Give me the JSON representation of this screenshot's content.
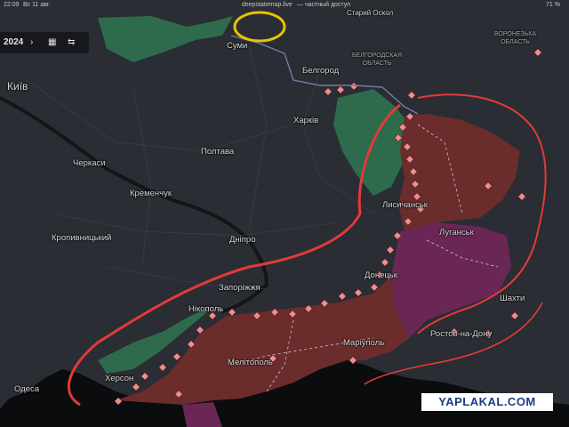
{
  "status_bar": {
    "time": "22:09",
    "date": "Вс 11 авг.",
    "url": "deepstatemap.live",
    "url_note": "— частный доступ",
    "battery": "71 %"
  },
  "toolbar": {
    "year": "2024",
    "next_icon": "chevron-right-icon",
    "calendar_icon": "calendar-icon",
    "collapse_icon": "collapse-arrows-icon"
  },
  "cities": {
    "sumy": "Суми",
    "belgorod": "Белгород",
    "belgorod_oblast": "БЕЛГОРОДСКАЯ\nОБЛАСТЬ",
    "voronezh_oblast": "ВОРОНЕЗЬКА\nОБЛАСТЬ",
    "stary_oskol": "Старий Оскол",
    "kharkiv": "Харків",
    "poltava": "Полтава",
    "cherkasy": "Черкаси",
    "kremenchuk": "Кременчук",
    "kropyvnytskyi": "Кропивницький",
    "dnipro": "Дніпро",
    "zaporizhzhia": "Запоріжжя",
    "nikopol": "Нікополь",
    "melitopol": "Мелітополь",
    "mariupol": "Маріуполь",
    "lysychansk": "Лисичанськ",
    "luhansk": "Луганськ",
    "donetsk": "Донецьк",
    "shakhty": "Шахти",
    "rostov": "Ростов-на-Дону",
    "kherson": "Херсон",
    "odesa": "Одеса",
    "kyiv": "Київ"
  },
  "watermark": "YAPLAKAL.COM",
  "colors": {
    "land": "#2a2d33",
    "occupied": "#6b2c2c",
    "occupied_pre2022": "#6a2755",
    "liberated": "#2e6b4c",
    "contested": "#ec8f8f",
    "annotation_red": "#e23a3a",
    "annotation_yellow": "#e6c400",
    "water": "#000000"
  }
}
